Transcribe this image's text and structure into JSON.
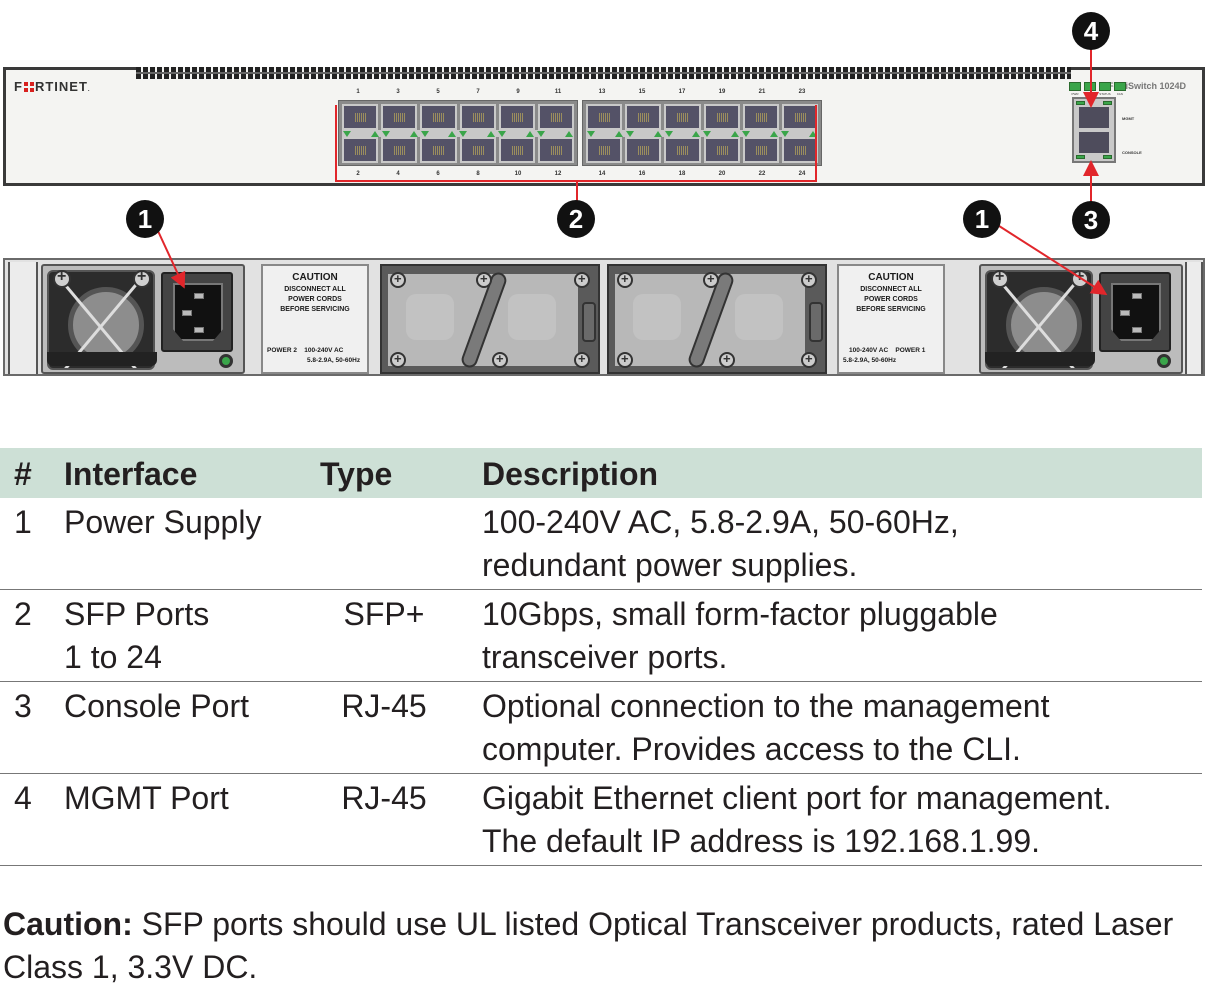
{
  "front_panel": {
    "logo": "FORTINET",
    "model": "FortiSwitch 1024D",
    "ports_top_left": [
      "1",
      "3",
      "5",
      "7",
      "9",
      "11"
    ],
    "ports_bottom_left": [
      "2",
      "4",
      "6",
      "8",
      "10",
      "12"
    ],
    "ports_top_right": [
      "13",
      "15",
      "17",
      "19",
      "21",
      "23"
    ],
    "ports_bottom_right": [
      "14",
      "16",
      "18",
      "20",
      "22",
      "24"
    ],
    "status_leds": [
      "PWR",
      "PWR",
      "STATUS",
      "FAN"
    ],
    "mgmt_label": "MGMT",
    "console_label": "CONSOLE"
  },
  "rear_panel": {
    "left_caution": {
      "title": "CAUTION",
      "lines": [
        "DISCONNECT ALL",
        "POWER CORDS",
        "BEFORE SERVICING"
      ],
      "power_id": "POWER 2",
      "rating_voltage": "100-240V AC",
      "rating_current": "5.8-2.9A, 50-60Hz"
    },
    "right_caution": {
      "title": "CAUTION",
      "lines": [
        "DISCONNECT ALL",
        "POWER CORDS",
        "BEFORE SERVICING"
      ],
      "power_id": "POWER 1",
      "rating_voltage": "100-240V AC",
      "rating_current": "5.8-2.9A, 50-60Hz"
    }
  },
  "callouts": [
    "1",
    "2",
    "1",
    "3",
    "4"
  ],
  "table": {
    "headers": [
      "#",
      "Interface",
      "Type",
      "Description"
    ],
    "rows": [
      {
        "num": "1",
        "interface": [
          "Power Supply"
        ],
        "type": "",
        "description": [
          "100-240V AC, 5.8-2.9A, 50-60Hz,",
          "redundant power supplies."
        ]
      },
      {
        "num": "2",
        "interface": [
          "SFP Ports",
          "1 to 24"
        ],
        "type": "SFP+",
        "description": [
          "10Gbps, small form-factor pluggable",
          "transceiver ports."
        ]
      },
      {
        "num": "3",
        "interface": [
          "Console Port"
        ],
        "type": "RJ-45",
        "description": [
          "Optional connection to the management",
          "computer. Provides access to the CLI."
        ]
      },
      {
        "num": "4",
        "interface": [
          "MGMT Port"
        ],
        "type": "RJ-45",
        "description": [
          "Gigabit Ethernet client port for management.",
          "The default IP address is 192.168.1.99."
        ]
      }
    ]
  },
  "caution_note": {
    "label": "Caution:",
    "text": " SFP ports should use UL listed Optical Transceiver products, rated Laser Class 1, 3.3V DC."
  },
  "colors": {
    "header_bg": "#cde0d6",
    "callout_arrow": "#e1262b",
    "led_green": "#3aa54a"
  }
}
